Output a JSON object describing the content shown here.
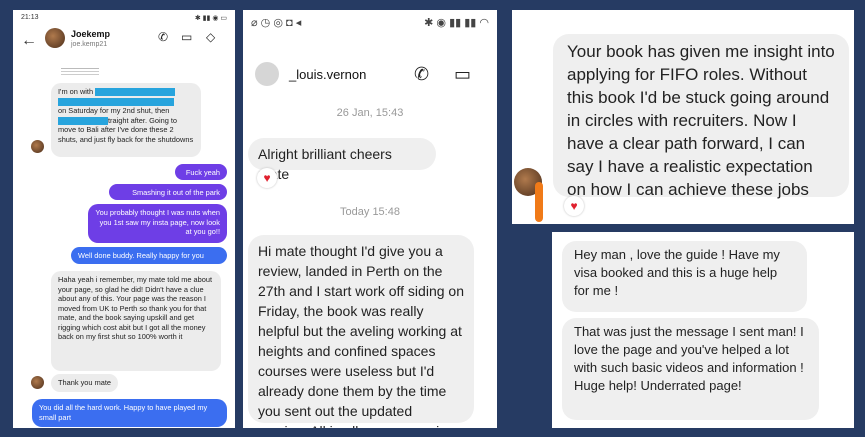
{
  "panel1": {
    "status_time": "21:13",
    "contact_name": "Joekemp",
    "contact_handle": "joe.kemp21",
    "messages": [
      {
        "dir": "in",
        "text_a": "I'm on with",
        "text_b": "on Saturday for my 2nd shut, then",
        "text_c": "traight after. Going to move to Bali after I've done these 2 shuts, and just fly back for the shutdowns"
      },
      {
        "dir": "out",
        "text": "Fuck yeah"
      },
      {
        "dir": "out",
        "text": "Smashing it out of the park"
      },
      {
        "dir": "out",
        "text": "You probably thought I was nuts when you 1st saw my insta page, now look at you go!!"
      },
      {
        "dir": "outb",
        "text": "Well done buddy. Really happy for you"
      },
      {
        "dir": "in",
        "text": "Haha yeah i remember, my mate told me about your page, so glad he did! Didn't have a clue about any of this. Your page was the reason I moved from UK to Perth so thank you for that mate, and the book saying upskill and get rigging which cost abit but I got all the money back on my first shut so 100% worth it"
      },
      {
        "dir": "in",
        "text": "Thank you mate"
      },
      {
        "dir": "outb",
        "text": "You did all the hard work. Happy to have played my small part"
      }
    ]
  },
  "panel2": {
    "contact_name": "_louis.vernon",
    "timestamp1": "26 Jan, 15:43",
    "message1": "Alright brilliant cheers mate",
    "timestamp2": "Today 15:48",
    "message2": "Hi mate thought I'd give you a review, landed in Perth on the 27th and I start work off siding on Friday, the book was really helpful but the aveling working at heights and confined spaces courses were useless but I'd already done them by the time you sent out the updated version. All in all was a massive help though mate cheers"
  },
  "panel3": {
    "message": "Your book has given me insight into applying for FIFO roles. Without this book I'd be stuck going around in circles with recruiters. Now I have a clear path forward, I can say I have a realistic expectation on how I can achieve these jobs"
  },
  "panel4": {
    "message1": "Hey man , love the guide ! Have my visa booked and this is a huge help for me !",
    "message2": "That was just the message I sent man! I love the page and you've helped a lot with such basic videos and information ! Huge help! Underrated page!"
  },
  "colors": {
    "background": "#263b63",
    "outgoing_purple": "#6e3ee6",
    "outgoing_blue": "#3b6ef0",
    "redaction": "#27a4dd",
    "heart": "#e0202e"
  }
}
